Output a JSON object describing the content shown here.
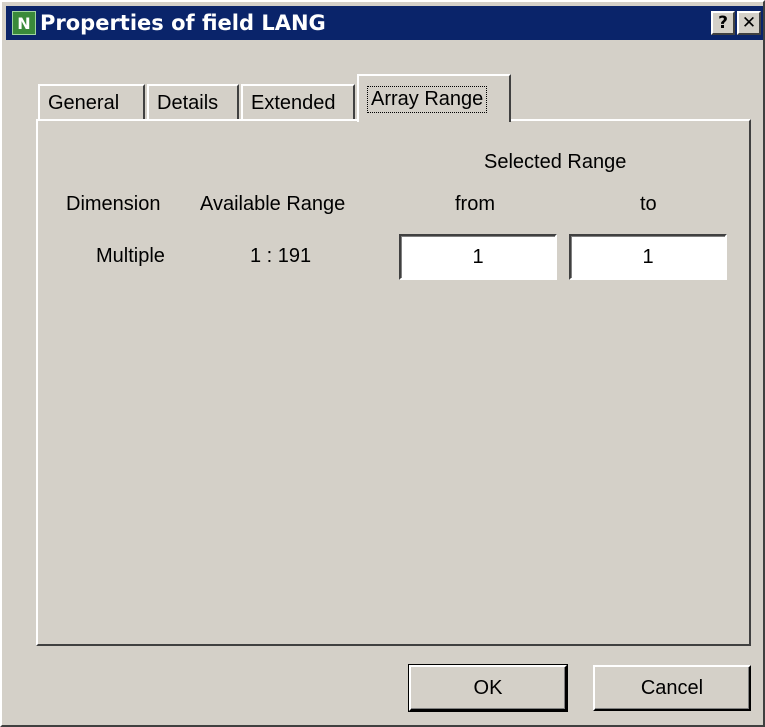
{
  "window": {
    "title": "Properties of field LANG",
    "icon_letter": "N",
    "help_label": "?",
    "close_label": "✕"
  },
  "tabs": [
    {
      "label": "General",
      "active": false
    },
    {
      "label": "Details",
      "active": false
    },
    {
      "label": "Extended",
      "active": false
    },
    {
      "label": "Array Range",
      "active": true
    }
  ],
  "panel": {
    "selected_range_heading": "Selected Range",
    "headers": {
      "dimension": "Dimension",
      "available_range": "Available Range",
      "from": "from",
      "to": "to"
    },
    "row": {
      "dimension": "Multiple",
      "available_range": "1 : 191",
      "from_value": "1",
      "to_value": "1"
    }
  },
  "buttons": {
    "ok": "OK",
    "cancel": "Cancel"
  }
}
